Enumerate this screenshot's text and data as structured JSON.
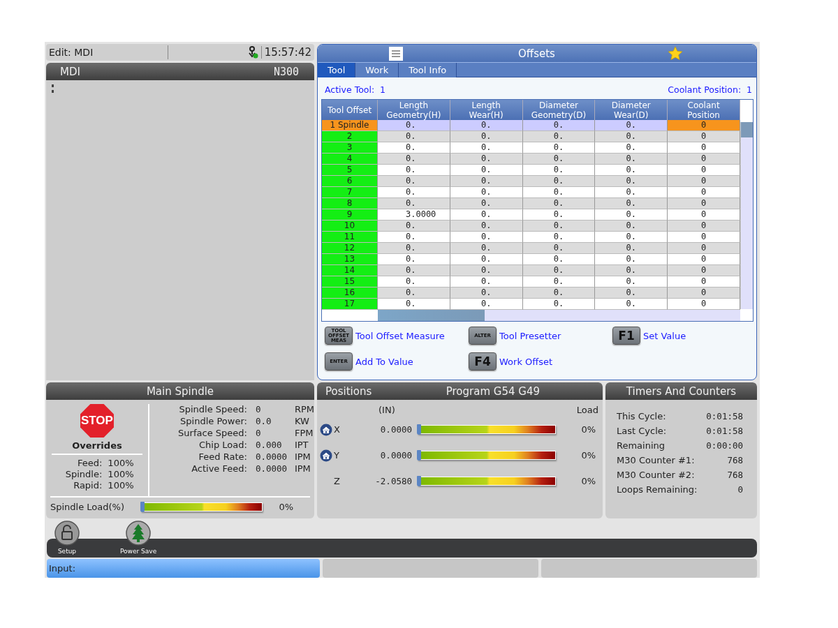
{
  "status": {
    "mode": "Edit: MDI",
    "time": "15:57:42"
  },
  "mdi": {
    "title": "MDI",
    "block": "N300"
  },
  "offsets": {
    "title": "Offsets",
    "tabs": [
      {
        "label": "Tool",
        "selected": true
      },
      {
        "label": "Work",
        "selected": false
      },
      {
        "label": "Tool Info",
        "selected": false
      }
    ],
    "active_tool": {
      "label": "Active Tool:",
      "value": "1"
    },
    "coolant": {
      "label": "Coolant Position:",
      "value": "1"
    },
    "table": {
      "columns": [
        "Tool Offset",
        "Length Geometry(H)",
        "Length Wear(H)",
        "Diameter Geometry(D)",
        "Diameter Wear(D)",
        "Coolant Position"
      ],
      "rows": [
        {
          "selected": true,
          "cells": [
            "1 Spindle",
            "0.",
            "0.",
            "0.",
            "0.",
            "0"
          ]
        },
        {
          "selected": false,
          "cells": [
            "2",
            "0.",
            "0.",
            "0.",
            "0.",
            "0"
          ]
        },
        {
          "selected": false,
          "cells": [
            "3",
            "0.",
            "0.",
            "0.",
            "0.",
            "0"
          ]
        },
        {
          "selected": false,
          "cells": [
            "4",
            "0.",
            "0.",
            "0.",
            "0.",
            "0"
          ]
        },
        {
          "selected": false,
          "cells": [
            "5",
            "0.",
            "0.",
            "0.",
            "0.",
            "0"
          ]
        },
        {
          "selected": false,
          "cells": [
            "6",
            "0.",
            "0.",
            "0.",
            "0.",
            "0"
          ]
        },
        {
          "selected": false,
          "cells": [
            "7",
            "0.",
            "0.",
            "0.",
            "0.",
            "0"
          ]
        },
        {
          "selected": false,
          "cells": [
            "8",
            "0.",
            "0.",
            "0.",
            "0.",
            "0"
          ]
        },
        {
          "selected": false,
          "cells": [
            "9",
            "3.0000",
            "0.",
            "0.",
            "0.",
            "0"
          ]
        },
        {
          "selected": false,
          "cells": [
            "10",
            "0.",
            "0.",
            "0.",
            "0.",
            "0"
          ]
        },
        {
          "selected": false,
          "cells": [
            "11",
            "0.",
            "0.",
            "0.",
            "0.",
            "0"
          ]
        },
        {
          "selected": false,
          "cells": [
            "12",
            "0.",
            "0.",
            "0.",
            "0.",
            "0"
          ]
        },
        {
          "selected": false,
          "cells": [
            "13",
            "0.",
            "0.",
            "0.",
            "0.",
            "0"
          ]
        },
        {
          "selected": false,
          "cells": [
            "14",
            "0.",
            "0.",
            "0.",
            "0.",
            "0"
          ]
        },
        {
          "selected": false,
          "cells": [
            "15",
            "0.",
            "0.",
            "0.",
            "0.",
            "0"
          ]
        },
        {
          "selected": false,
          "cells": [
            "16",
            "0.",
            "0.",
            "0.",
            "0.",
            "0"
          ]
        },
        {
          "selected": false,
          "cells": [
            "17",
            "0.",
            "0.",
            "0.",
            "0.",
            "0"
          ]
        }
      ]
    },
    "keys": [
      {
        "key": "TOOL OFFSET MEAS",
        "kind": "small",
        "label": "Tool Offset Measure"
      },
      {
        "key": "ALTER",
        "kind": "small",
        "label": "Tool Presetter"
      },
      {
        "key": "F1",
        "kind": "large",
        "label": "Set Value"
      },
      {
        "key": "ENTER",
        "kind": "small",
        "label": "Add To Value"
      },
      {
        "key": "F4",
        "kind": "large",
        "label": "Work Offset"
      }
    ]
  },
  "spindle": {
    "title": "Main Spindle",
    "stop": "STOP",
    "overrides_title": "Overrides",
    "overrides": [
      {
        "label": "Feed:",
        "value": "100%"
      },
      {
        "label": "Spindle:",
        "value": "100%"
      },
      {
        "label": "Rapid:",
        "value": "100%"
      }
    ],
    "readings": [
      {
        "label": "Spindle Speed:",
        "value": "0",
        "unit": "RPM"
      },
      {
        "label": "Spindle Power:",
        "value": "0.0",
        "unit": "KW"
      },
      {
        "label": "Surface Speed:",
        "value": "0",
        "unit": "FPM"
      },
      {
        "label": "Chip Load:",
        "value": "0.000",
        "unit": "IPT"
      },
      {
        "label": "Feed Rate:",
        "value": "0.0000",
        "unit": "IPM"
      },
      {
        "label": "Active Feed:",
        "value": "0.0000",
        "unit": "IPM"
      }
    ],
    "load": {
      "label": "Spindle Load(%)",
      "level": 0,
      "reading": "0%"
    }
  },
  "positions": {
    "title": "Positions",
    "program": "Program G54 G49",
    "units": "(IN)",
    "load_heading": "Load",
    "axes": [
      {
        "axis": "X",
        "homed": true,
        "value": "0.0000",
        "level": 0,
        "reading": "0%"
      },
      {
        "axis": "Y",
        "homed": true,
        "value": "0.0000",
        "level": 0,
        "reading": "0%"
      },
      {
        "axis": "Z",
        "homed": false,
        "value": "-2.0580",
        "level": 0,
        "reading": "0%"
      }
    ]
  },
  "timers": {
    "title": "Timers And Counters",
    "items": [
      {
        "label": "This Cycle:",
        "value": "0:01:58"
      },
      {
        "label": "Last Cycle:",
        "value": "0:01:58"
      },
      {
        "label": "Remaining",
        "value": "0:00:00"
      },
      {
        "label": "M30 Counter #1:",
        "value": "768"
      },
      {
        "label": "M30 Counter #2:",
        "value": "768"
      },
      {
        "label": "Loops Remaining:",
        "value": "0"
      }
    ]
  },
  "dock": [
    {
      "kind": "lock",
      "label": "Setup"
    },
    {
      "kind": "tree",
      "label": "Power Save"
    }
  ],
  "input": {
    "label": "Input:"
  }
}
